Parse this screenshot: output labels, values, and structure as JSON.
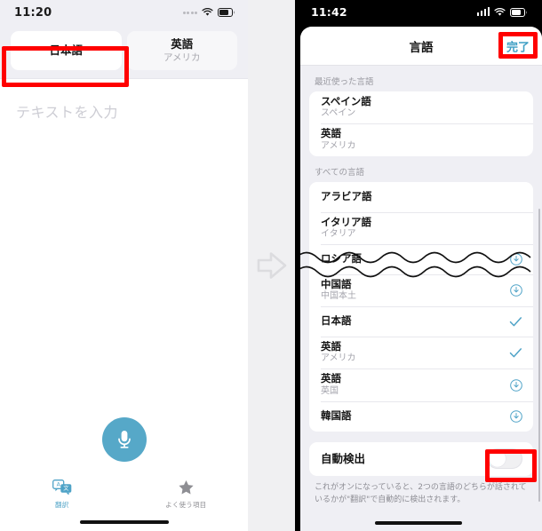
{
  "left_phone": {
    "status_bar": {
      "time": "11:20",
      "signal_icon": "signal-dots-icon",
      "wifi_icon": "wifi-icon",
      "battery_icon": "battery-icon"
    },
    "language_segment": {
      "source": {
        "title": "日本語",
        "subtitle": "",
        "selected": true
      },
      "target": {
        "title": "英語",
        "subtitle": "アメリカ",
        "selected": false
      }
    },
    "input": {
      "placeholder": "テキストを入力",
      "value": ""
    },
    "mic_button": {
      "icon": "microphone-icon",
      "color": "#56a8c8"
    },
    "tab_bar": [
      {
        "label": "翻訳",
        "icon": "translate-icon",
        "active": true
      },
      {
        "label": "よく使う項目",
        "icon": "star-icon",
        "active": false
      }
    ]
  },
  "transition_arrow": {
    "icon": "arrow-right-icon",
    "color": "#dcdcdf"
  },
  "right_phone": {
    "status_bar": {
      "time": "11:42",
      "signal_icon": "signal-bars-icon",
      "wifi_icon": "wifi-icon",
      "battery_icon": "battery-icon"
    },
    "nav_bar": {
      "title": "言語",
      "done_label": "完了",
      "done_color": "#3f9fc4"
    },
    "recent_section": {
      "header": "最近使った言語",
      "items": [
        {
          "title": "スペイン語",
          "subtitle": "スペイン",
          "accessory": "none"
        },
        {
          "title": "英語",
          "subtitle": "アメリカ",
          "accessory": "none"
        }
      ]
    },
    "all_section": {
      "header": "すべての言語",
      "items_before_break": [
        {
          "title": "アラビア語",
          "subtitle": "",
          "accessory": "none"
        },
        {
          "title": "イタリア語",
          "subtitle": "イタリア",
          "accessory": "none"
        }
      ],
      "items_after_break": [
        {
          "title": "ロシア語",
          "subtitle": "",
          "accessory": "download"
        },
        {
          "title": "中国語",
          "subtitle": "中国本土",
          "accessory": "download"
        },
        {
          "title": "日本語",
          "subtitle": "",
          "accessory": "check"
        },
        {
          "title": "英語",
          "subtitle": "アメリカ",
          "accessory": "check"
        },
        {
          "title": "英語",
          "subtitle": "英国",
          "accessory": "download"
        },
        {
          "title": "韓国語",
          "subtitle": "",
          "accessory": "download"
        }
      ]
    },
    "auto_detect": {
      "label": "自動検出",
      "toggle_state": "off",
      "footer": "これがオンになっていると、2つの言語のどちらが話されているかが\"翻訳\"で自動的に検出されます。"
    }
  },
  "annotations": [
    {
      "name": "highlight-source-language-tab",
      "color": "#ff0000"
    },
    {
      "name": "highlight-done-button",
      "color": "#ff0000"
    },
    {
      "name": "highlight-auto-detect-toggle",
      "color": "#ff0000"
    }
  ]
}
